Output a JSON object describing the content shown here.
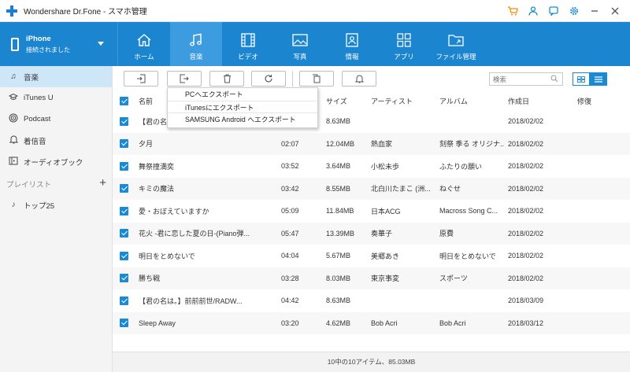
{
  "app": {
    "title": "Wondershare Dr.Fone - スマホ管理"
  },
  "device": {
    "name": "iPhone",
    "status": "接続されました"
  },
  "nav": [
    {
      "label": "ホーム",
      "icon": "home-icon"
    },
    {
      "label": "音楽",
      "icon": "music-icon"
    },
    {
      "label": "ビデオ",
      "icon": "video-icon"
    },
    {
      "label": "写真",
      "icon": "photo-icon"
    },
    {
      "label": "情報",
      "icon": "contacts-icon"
    },
    {
      "label": "アプリ",
      "icon": "apps-icon"
    },
    {
      "label": "ファイル管理",
      "icon": "folder-icon"
    }
  ],
  "sidebar": {
    "items": [
      {
        "label": "音楽",
        "icon": "music-note-icon"
      },
      {
        "label": "iTunes U",
        "icon": "graduation-cap-icon"
      },
      {
        "label": "Podcast",
        "icon": "podcast-icon"
      },
      {
        "label": "着信音",
        "icon": "bell-icon"
      },
      {
        "label": "オーディオブック",
        "icon": "audiobook-icon"
      }
    ],
    "playlist_header": "プレイリスト",
    "playlists": [
      {
        "label": "トップ25",
        "icon": "playlist-icon"
      }
    ]
  },
  "toolbar": {
    "search_placeholder": "検索"
  },
  "export_menu": [
    "PCへエクスポート",
    "iTunesにエクスポート",
    "SAMSUNG Android へエクスポート"
  ],
  "table": {
    "headers": [
      "名前",
      "",
      "サイズ",
      "アーティスト",
      "アルバム",
      "作成日",
      "修復"
    ],
    "rows": [
      {
        "name": "【君の名",
        "time": "",
        "size": "8.63MB",
        "artist": "",
        "album": "",
        "date": "2018/02/02"
      },
      {
        "name": "夕月",
        "time": "02:07",
        "size": "12.04MB",
        "artist": "熱血家",
        "album": "刻祭 季る オリジナ...",
        "date": "2018/02/02"
      },
      {
        "name": "舞祭撞満奕",
        "time": "03:52",
        "size": "3.64MB",
        "artist": "小松未歩",
        "album": "ふたりの願い",
        "date": "2018/02/02"
      },
      {
        "name": "キミの魔法",
        "time": "03:42",
        "size": "8.55MB",
        "artist": "北白川たまこ (洲...",
        "album": "ねぐせ",
        "date": "2018/02/02"
      },
      {
        "name": "愛・おぼえていますか",
        "time": "05:09",
        "size": "11.84MB",
        "artist": "日本ACG",
        "album": "Macross Song C...",
        "date": "2018/02/02"
      },
      {
        "name": "花火 -君に恋した夏の日-(Piano弾...",
        "time": "05:47",
        "size": "13.39MB",
        "artist": "奏華子",
        "album": "原費",
        "date": "2018/02/02"
      },
      {
        "name": "明日をとめないで",
        "time": "04:04",
        "size": "5.67MB",
        "artist": "美郷あき",
        "album": "明日をとめないで",
        "date": "2018/02/02"
      },
      {
        "name": "勝ち戦",
        "time": "03:28",
        "size": "8.03MB",
        "artist": "東京事変",
        "album": "スポーツ",
        "date": "2018/02/02"
      },
      {
        "name": "【君の名は。】前前前世/RADW...",
        "time": "04:42",
        "size": "8.63MB",
        "artist": "",
        "album": "",
        "date": "2018/03/09"
      },
      {
        "name": "Sleep Away",
        "time": "03:20",
        "size": "4.62MB",
        "artist": "Bob Acri",
        "album": "Bob Acri",
        "date": "2018/03/12"
      }
    ]
  },
  "footer": {
    "status": "10中の10アイテム、85.03MB"
  }
}
